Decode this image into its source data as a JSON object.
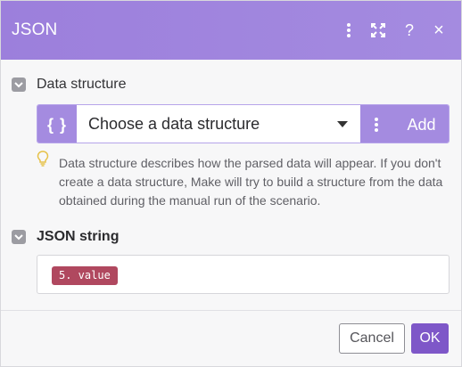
{
  "window": {
    "title": "JSON",
    "toolbar_icons": [
      "kebab-menu-icon",
      "expand-icon",
      "help-icon",
      "close-icon"
    ],
    "help_glyph": "?",
    "close_glyph": "×"
  },
  "data_structure": {
    "label": "Data structure",
    "brace_glyph": "{ }",
    "select_value": "Choose a data structure",
    "add_label": "Add",
    "hint": "Data structure describes how the parsed data will appear. If you don't create a data structure, Make will try to build a structure from the data obtained during the manual run of the scenario."
  },
  "json_string": {
    "label": "JSON string",
    "pill_value": "5. value"
  },
  "footer": {
    "cancel_label": "Cancel",
    "ok_label": "OK"
  },
  "colors": {
    "header": "#a48be0",
    "accent": "#7e57c8",
    "pill": "#b0485f"
  }
}
